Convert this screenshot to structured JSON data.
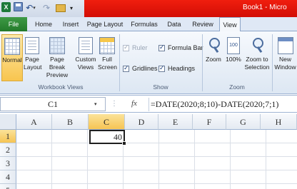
{
  "window": {
    "title": "Book1 - Micro"
  },
  "quick_access": {
    "app_logo": "X",
    "undo_caret": "▾",
    "more": "▾"
  },
  "tabs": [
    "File",
    "Home",
    "Insert",
    "Page Layout",
    "Formulas",
    "Data",
    "Review",
    "View"
  ],
  "active_tab": "View",
  "ribbon": {
    "workbook_views": {
      "label": "Workbook Views",
      "normal": "Normal",
      "page_layout_1": "Page",
      "page_layout_2": "Layout",
      "page_break_1": "Page Break",
      "page_break_2": "Preview",
      "custom_1": "Custom",
      "custom_2": "Views",
      "full_1": "Full",
      "full_2": "Screen"
    },
    "show": {
      "label": "Show",
      "ruler": "Ruler",
      "gridlines": "Gridlines",
      "formula_bar": "Formula Bar",
      "headings": "Headings"
    },
    "zoom": {
      "label": "Zoom",
      "zoom": "Zoom",
      "hundred": "100%",
      "hundred_icon": "100",
      "to_selection_1": "Zoom to",
      "to_selection_2": "Selection"
    },
    "window": {
      "new_1": "New",
      "new_2": "Window"
    }
  },
  "formula_bar": {
    "name_box": "C1",
    "name_box_arrow": "▾",
    "dots": "⋮",
    "fx": "fx",
    "formula": "=DATE(2020;8;10)-DATE(2020;7;1)"
  },
  "grid": {
    "columns": [
      "A",
      "B",
      "C",
      "D",
      "E",
      "F",
      "G",
      "H"
    ],
    "rows": [
      "1",
      "2",
      "3",
      "4",
      "5"
    ],
    "active_cell_value": "40"
  }
}
